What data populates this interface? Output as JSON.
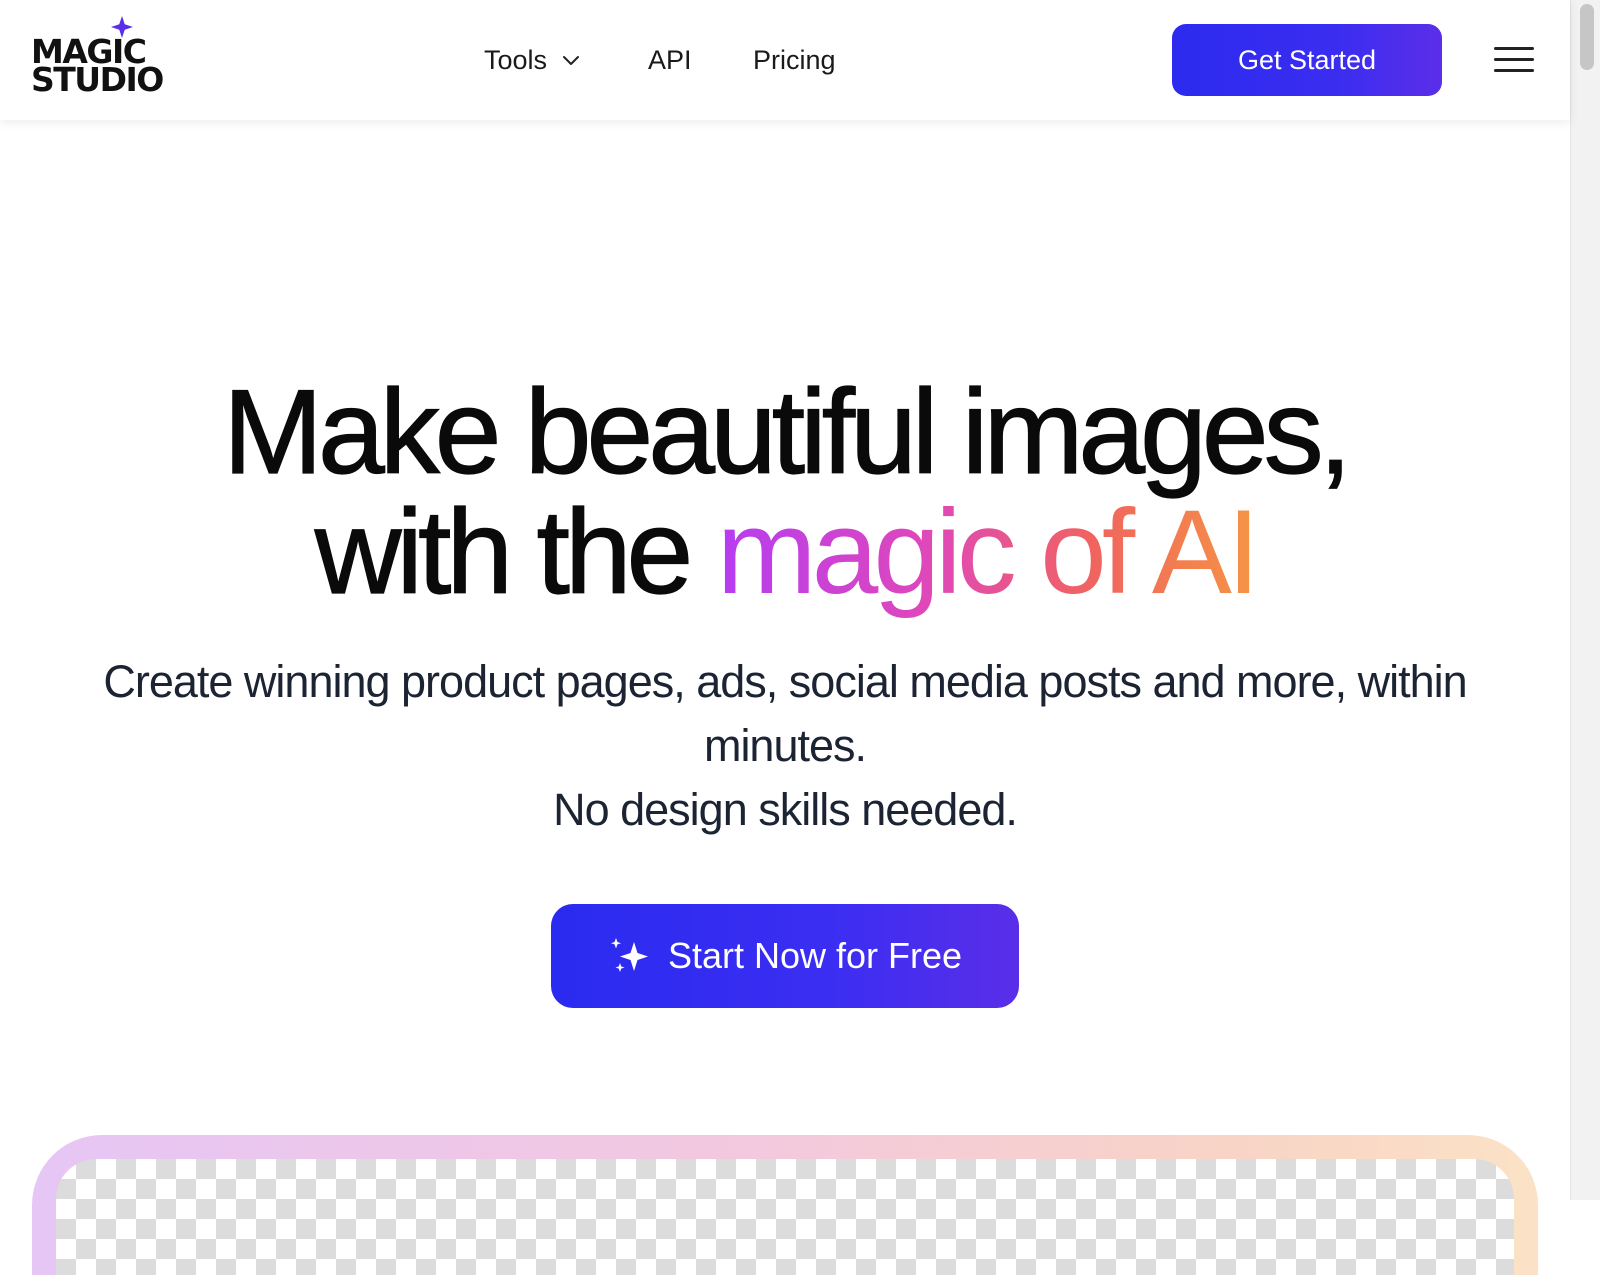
{
  "header": {
    "logo_line1": "MAGIC",
    "logo_line2": "STUDIO",
    "nav": {
      "tools_label": "Tools",
      "api_label": "API",
      "pricing_label": "Pricing"
    },
    "get_started_label": "Get Started",
    "menu_icon": "hamburger-menu-icon"
  },
  "hero": {
    "headline_line1": "Make beautiful images,",
    "headline_line2_plain": "with the ",
    "headline_line2_gradient": "magic of AI",
    "subtitle_line1": "Create winning product pages, ads, social media posts and more, within minutes.",
    "subtitle_line2": "No design skills needed.",
    "cta_label": "Start Now for Free",
    "cta_icon": "sparkles-icon"
  },
  "colors": {
    "brand_blue": "#2c2bef",
    "brand_purple": "#5b2ee8",
    "gradient_start": "#b63cf2",
    "gradient_end": "#f59445",
    "logo_star": "#5b2ee8"
  }
}
